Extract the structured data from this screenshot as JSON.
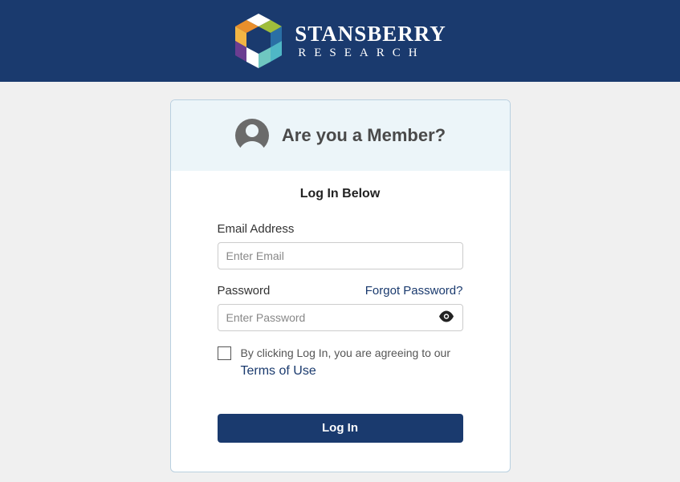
{
  "header": {
    "brand_main": "STANSBERRY",
    "brand_sub": "RESEARCH"
  },
  "card": {
    "member_question": "Are you a Member?",
    "login_below": "Log In Below",
    "email_label": "Email Address",
    "email_placeholder": "Enter Email",
    "password_label": "Password",
    "forgot_password": "Forgot Password?",
    "password_placeholder": "Enter Password",
    "terms_prefix": "By clicking Log In, you are agreeing to our",
    "terms_link": "Terms of Use",
    "login_button": "Log In"
  }
}
